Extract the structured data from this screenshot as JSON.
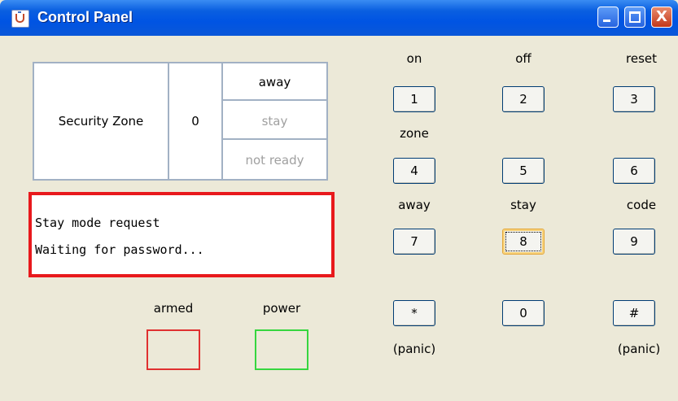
{
  "window": {
    "title": "Control Panel",
    "controls": [
      "minimize",
      "maximize",
      "close"
    ],
    "close_glyph": "X"
  },
  "zone": {
    "label": "Security Zone",
    "value": "0",
    "modes": [
      {
        "label": "away",
        "active": true
      },
      {
        "label": "stay",
        "active": false
      },
      {
        "label": "not ready",
        "active": false
      }
    ]
  },
  "display": {
    "line1": "Stay mode request",
    "line2": "Waiting for password...",
    "border_color": "#E8191C"
  },
  "indicators": {
    "armed": {
      "label": "armed",
      "color": "#E03030"
    },
    "power": {
      "label": "power",
      "color": "#36D63F"
    }
  },
  "keypad": {
    "labels": {
      "on": "on",
      "off": "off",
      "reset": "reset",
      "zone": "zone",
      "away": "away",
      "stay": "stay",
      "code": "code",
      "panic_left": "(panic)",
      "panic_right": "(panic)"
    },
    "keys": {
      "k1": "1",
      "k2": "2",
      "k3": "3",
      "k4": "4",
      "k5": "5",
      "k6": "6",
      "k7": "7",
      "k8": "8",
      "k9": "9",
      "star": "*",
      "k0": "0",
      "hash": "#"
    },
    "focused_key": "8"
  }
}
